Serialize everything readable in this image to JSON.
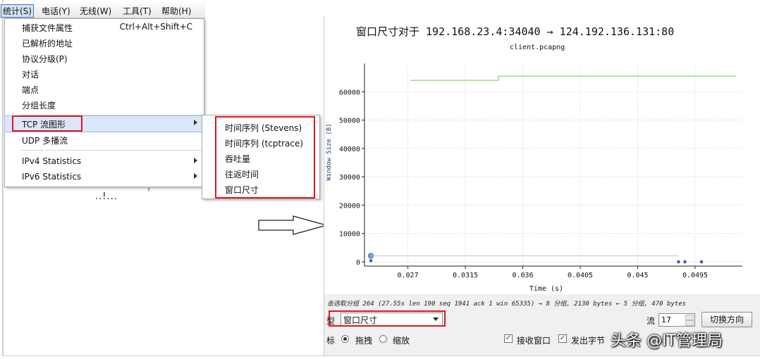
{
  "menubar": {
    "items": [
      {
        "label": "统计(S)"
      },
      {
        "label": "电话(Y)"
      },
      {
        "label": "无线(W)"
      },
      {
        "label": "工具(T)"
      },
      {
        "label": "帮助(H)"
      }
    ]
  },
  "stats_menu": {
    "items": [
      {
        "label": "捕获文件属性",
        "shortcut": "Ctrl+Alt+Shift+C"
      },
      {
        "label": "已解析的地址"
      },
      {
        "label": "协议分级(P)"
      },
      {
        "label": "对话"
      },
      {
        "label": "端点"
      },
      {
        "label": "分组长度"
      },
      {
        "label": "TCP 流图形"
      },
      {
        "label": "UDP 多播流"
      },
      {
        "label": "IPv4 Statistics"
      },
      {
        "label": "IPv6 Statistics"
      }
    ],
    "fragment_text": "..!...",
    "behind_text": "，"
  },
  "tcp_submenu": {
    "items": [
      {
        "label": "时间序列 (Stevens)"
      },
      {
        "label": "时间序列 (tcptrace)"
      },
      {
        "label": "吞吐量"
      },
      {
        "label": "往返时间"
      },
      {
        "label": "窗口尺寸"
      }
    ]
  },
  "graph_window": {
    "title": "窗口尺寸对于 192.168.23.4:34040 → 124.192.136.131:80",
    "subtitle": "client.pcapng",
    "status_text": "击选取分组 264 (27.55s len 190 seq 1941 ack 1 win 65335) → 8 分组, 2130 bytes ← 5 分组, 470 bytes",
    "type_label": "型",
    "type_value": "窗口尺寸",
    "stream_label": "流",
    "stream_value": "17",
    "switch_button": "切换方向",
    "mouse_label": "标",
    "radio_drag": "拖拽",
    "radio_zoom": "缩放",
    "check_rwin": "接收窗口",
    "check_bytes": "发出字节",
    "check_mark": "✓"
  },
  "watermark": "头条 @IT管理局",
  "colors": {
    "highlight_red": "#e0161c",
    "window_line": "#8fd17b",
    "bytes_marker": "#3a63b0"
  },
  "chart_data": {
    "type": "line",
    "xlabel": "Time (s)",
    "ylabel": "Window Size (B)",
    "xlim": [
      0.0236,
      0.0532
    ],
    "ylim": [
      -1500,
      69000
    ],
    "x_ticks": [
      "0.027",
      "0.0315",
      "0.036",
      "0.0405",
      "0.045",
      "0.0495"
    ],
    "x_tick_values": [
      0.027,
      0.0315,
      0.036,
      0.0405,
      0.045,
      0.0495
    ],
    "y_ticks": [
      "0",
      "10000",
      "20000",
      "30000",
      "40000",
      "50000",
      "60000"
    ],
    "y_tick_values": [
      0,
      10000,
      20000,
      30000,
      40000,
      50000,
      60000
    ],
    "series": [
      {
        "name": "接收窗口",
        "kind": "step",
        "x": [
          0.0272,
          0.0341,
          0.0341,
          0.0527
        ],
        "y": [
          64000,
          64000,
          65500,
          65500
        ]
      },
      {
        "name": "发出字节",
        "kind": "points",
        "x": [
          0.0241,
          0.0241,
          0.0482,
          0.0487,
          0.05
        ],
        "y": [
          2130,
          400,
          0,
          0,
          0
        ]
      },
      {
        "name": "",
        "kind": "faint-line",
        "x": [
          0.0241,
          0.0482
        ],
        "y": [
          2130,
          2130
        ]
      }
    ]
  }
}
